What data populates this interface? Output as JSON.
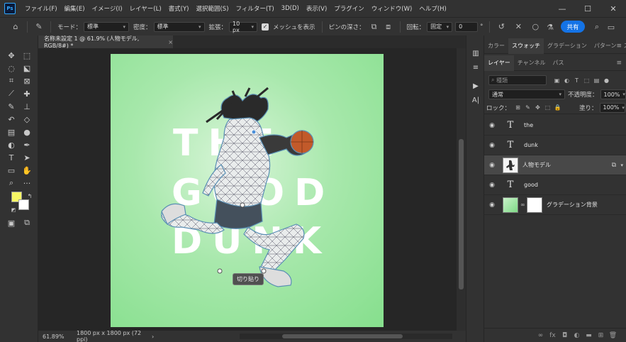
{
  "app": {
    "logo_text": "Ps",
    "menu": [
      "ファイル(F)",
      "編集(E)",
      "イメージ(I)",
      "レイヤー(L)",
      "書式(Y)",
      "選択範囲(S)",
      "フィルター(T)",
      "3D(D)",
      "表示(V)",
      "プラグイン",
      "ウィンドウ(W)",
      "ヘルプ(H)"
    ],
    "window_controls": {
      "minimize": "—",
      "maximize": "☐",
      "close": "✕"
    }
  },
  "options_bar": {
    "mode_label": "モード：",
    "mode_value": "標準",
    "density_label": "密度：",
    "density_value": "標準",
    "expand_label": "拡張：",
    "expand_value": "10 px",
    "show_mesh_label": "メッシュを表示",
    "pin_depth_label": "ピンの深さ：",
    "rotate_label": "回転：",
    "rotate_mode": "固定",
    "rotate_value": "0",
    "degree_symbol": "°",
    "share_label": "共有"
  },
  "document": {
    "tab_title": "名称未設定 1 @ 61.9% (人物モデル, RGB/8#) *",
    "tab_close": "×",
    "artwork_words": [
      "THE",
      "GOOD",
      "DUNK"
    ],
    "cut_button_label": "切り貼り"
  },
  "status": {
    "zoom": "61.89%",
    "doc_size": "1800 px x 1800 px (72 ppi)"
  },
  "panels": {
    "top_tabs": [
      "カラー",
      "スウォッチ",
      "グラデーション",
      "パターン",
      "スタイル"
    ],
    "top_active": "スウォッチ",
    "layer_tabs": [
      "レイヤー",
      "チャンネル",
      "パス"
    ],
    "layer_active": "レイヤー",
    "filter_placeholder": "種類",
    "blend_mode": "通常",
    "opacity_label": "不透明度：",
    "opacity_value": "100%",
    "lock_label": "ロック：",
    "fill_label": "塗り：",
    "fill_value": "100%",
    "layers": [
      {
        "name": "the",
        "kind": "text"
      },
      {
        "name": "dunk",
        "kind": "text"
      },
      {
        "name": "人物モデル",
        "kind": "image",
        "selected": true
      },
      {
        "name": "good",
        "kind": "text"
      },
      {
        "name": "グラデーション背景",
        "kind": "gradient-with-mask"
      }
    ]
  },
  "colors": {
    "foreground": "#f7f765",
    "background": "#ffffff",
    "accent": "#1473e6",
    "artboard_green": "#86df8d"
  }
}
